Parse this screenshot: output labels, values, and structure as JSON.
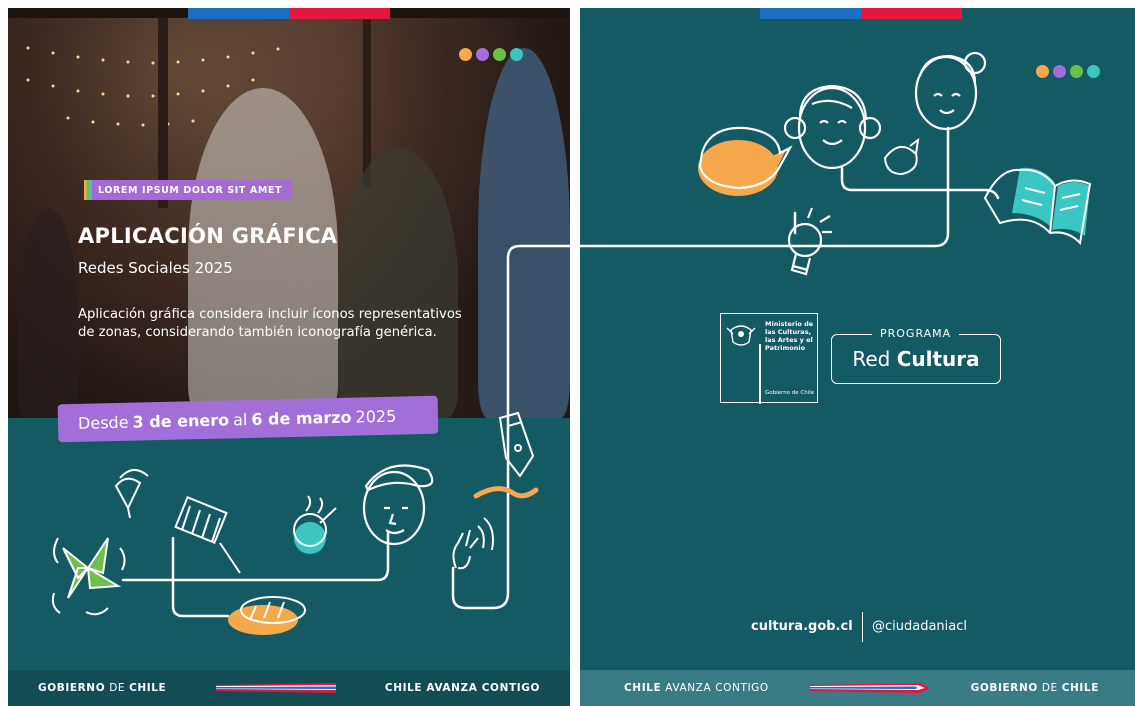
{
  "left": {
    "tag": "LOREM IPSUM DOLOR SIT AMET",
    "title": "APLICACIÓN GRÁFICA",
    "subtitle": "Redes Sociales 2025",
    "description": "Aplicación gráfica considera incluir íconos representativos de zonas, considerando también iconografía genérica.",
    "date": {
      "prefix": "Desde",
      "start": "3 de enero",
      "middle": "al",
      "end": "6 de marzo",
      "year": "2025"
    },
    "footer": {
      "gov_bold": "GOBIERNO",
      "gov_rest": "DE",
      "gov_bold2": "CHILE",
      "slogan": "CHILE AVANZA CONTIGO"
    }
  },
  "right": {
    "ministry": [
      "Ministerio de",
      "las Culturas,",
      "las Artes y el",
      "Patrimonio"
    ],
    "ministry_gov": "Gobierno de Chile",
    "program_label": "PROGRAMA",
    "program_name_light": "Red",
    "program_name_bold": "Cultura",
    "site": "cultura.gob.cl",
    "social": "@ciudadaniacl",
    "footer": {
      "slogan_bold": "CHILE",
      "slogan_rest": "AVANZA CONTIGO",
      "gov_bold": "GOBIERNO",
      "gov_rest": "DE",
      "gov_bold2": "CHILE"
    }
  },
  "colors": {
    "teal": "#145a62",
    "purple": "#a26ed8",
    "orange": "#f5a84c",
    "green": "#6cc04a",
    "mint": "#3cc6c3",
    "flag_blue": "#1d6fc4",
    "flag_red": "#e5173f"
  },
  "icons": [
    "spinning-top-icon",
    "grill-icon",
    "soup-pot-icon",
    "face-with-beret-icon",
    "pinwheel-icon",
    "bread-icon",
    "hand-icon",
    "quill-pen-icon",
    "speech-bubble-icon",
    "face-icon",
    "woman-face-icon",
    "lightbulb-icon",
    "open-book-icon",
    "coat-of-arms-icon"
  ]
}
